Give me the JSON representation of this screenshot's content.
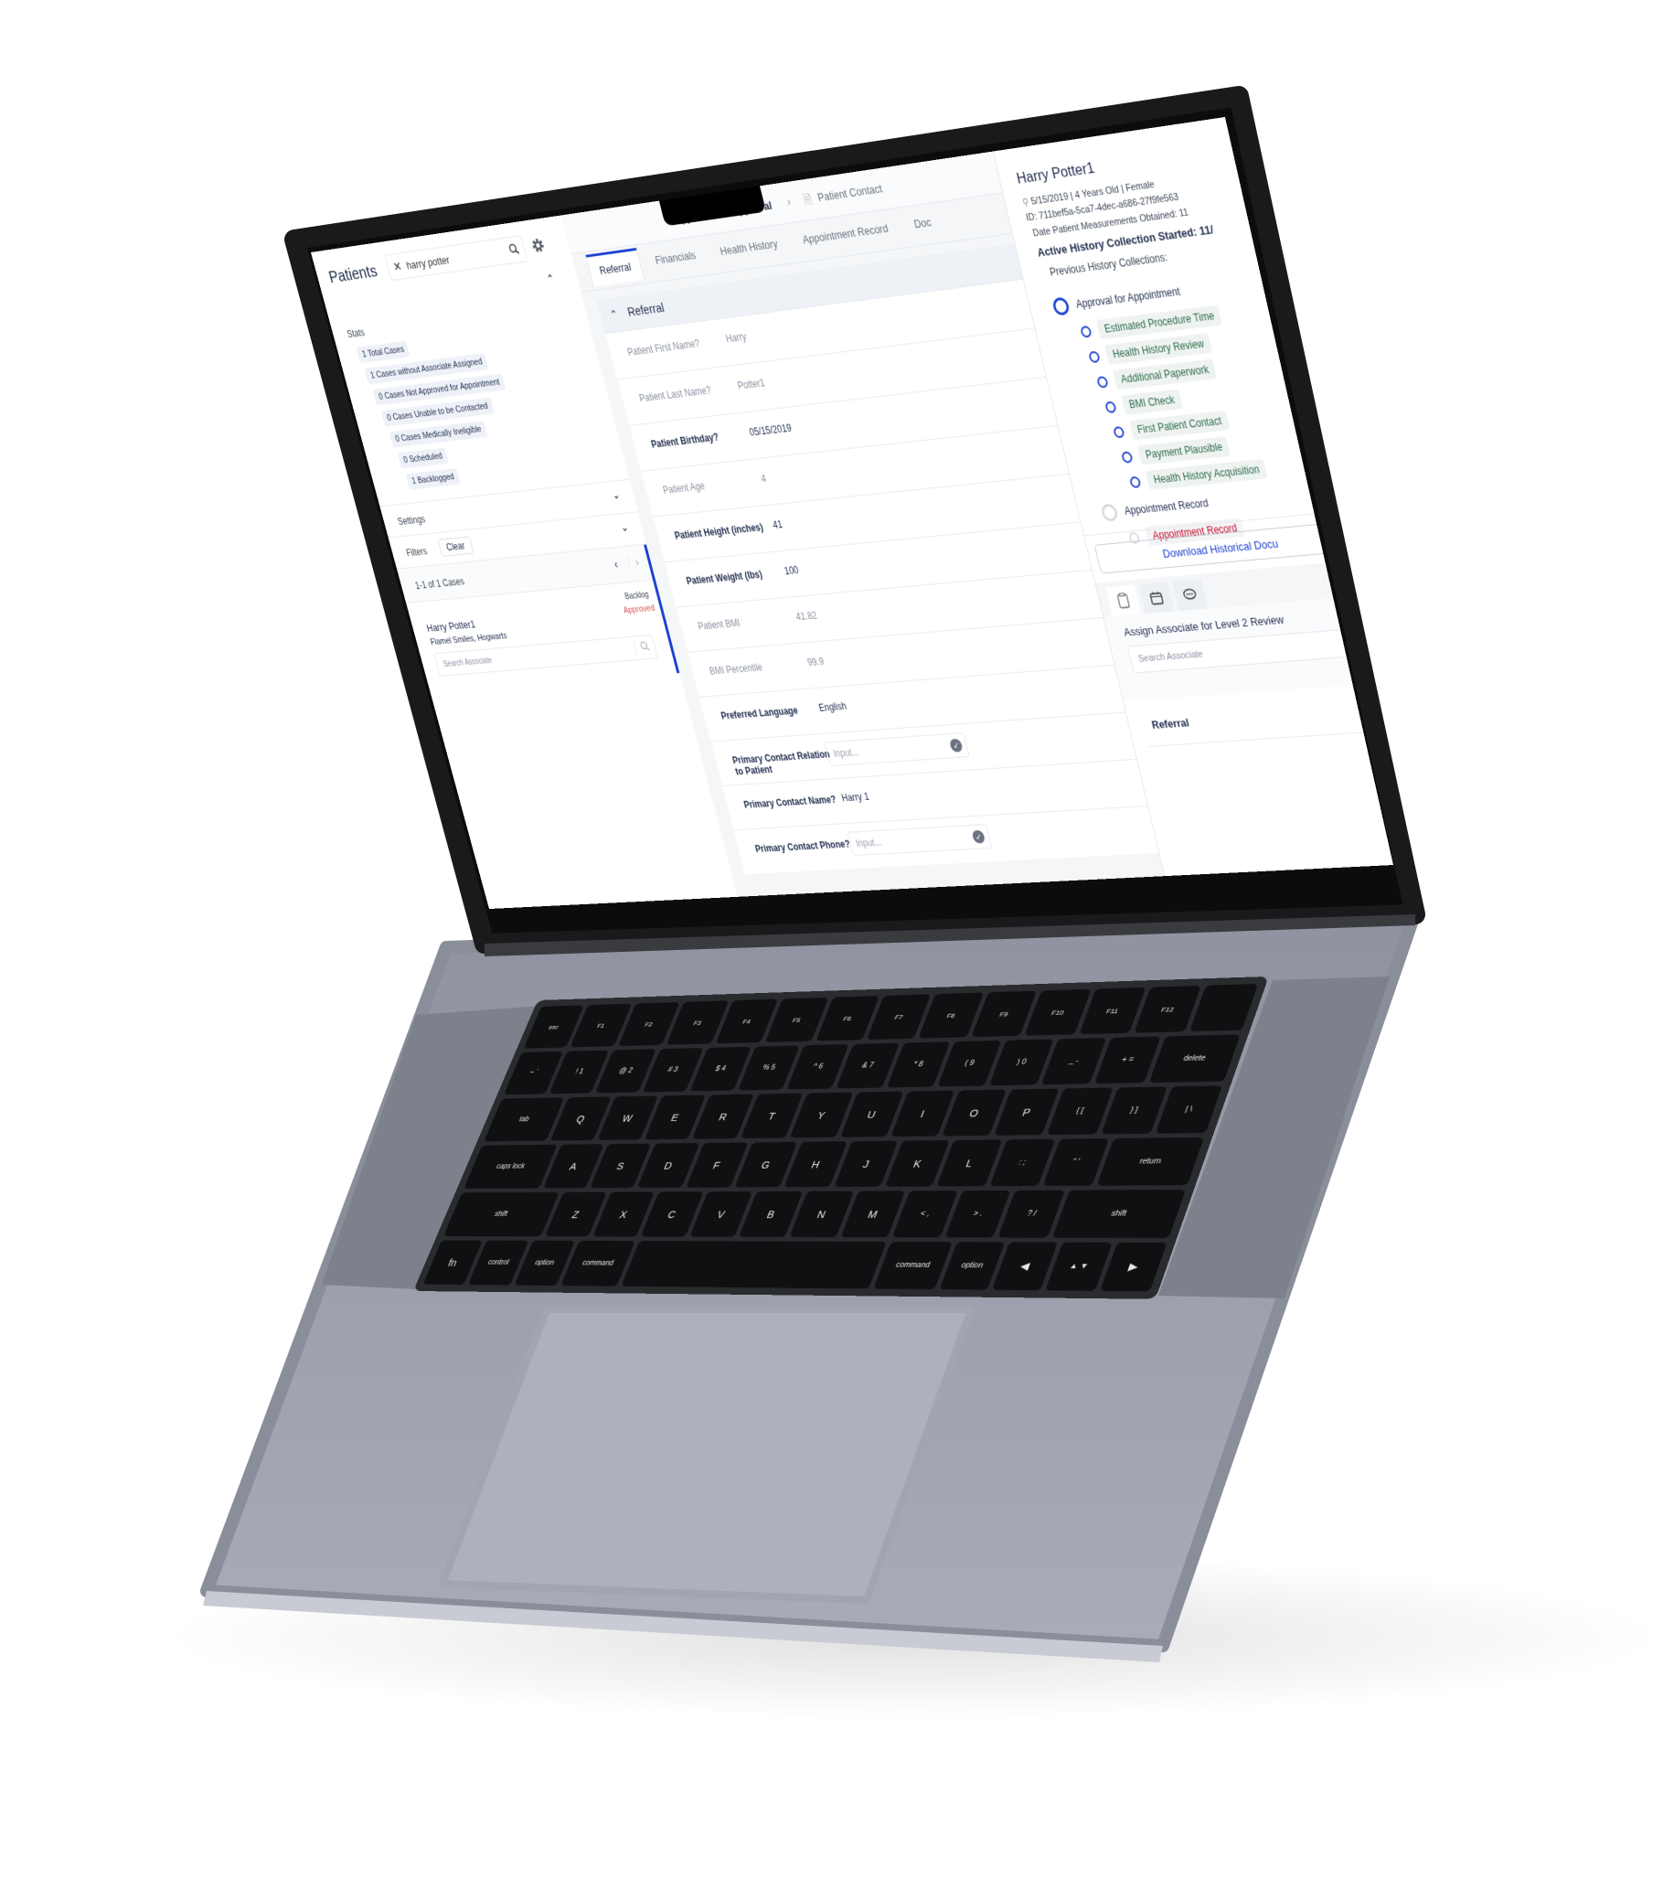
{
  "left": {
    "title": "Patients",
    "search_value": "harry potter",
    "stats_label": "Stats",
    "stats": [
      "1 Total Cases",
      "1 Cases without Associate Assigned",
      "0 Cases Not Approved for Appointment",
      "0 Cases Unable to be Contacted",
      "0 Cases Medically Ineligible",
      "0 Scheduled",
      "1 Backlogged"
    ],
    "settings_label": "Settings",
    "filters_label": "Filters",
    "clear_label": "Clear",
    "pagination": "1-1 of 1 Cases",
    "case": {
      "name": "Harry Potter1",
      "location": "Flamel Smiles, Hogwarts",
      "status": "Backlog",
      "approval": "Approved",
      "search_placeholder": "Search Associate"
    }
  },
  "middle": {
    "breadcrumb": [
      "Appointment Approval",
      "Patient Contact"
    ],
    "tabs": [
      "Referral",
      "Financials",
      "Health History",
      "Appointment Record",
      "Doc"
    ],
    "section_title": "Referral",
    "rows": [
      {
        "label": "Patient First Name?",
        "value": "Harry"
      },
      {
        "label": "Patient Last Name?",
        "value": "Potter1"
      },
      {
        "label": "Patient Birthday?",
        "value": "05/15/2019"
      },
      {
        "label": "Patient Age",
        "value": "4"
      },
      {
        "label": "Patient Height (inches)",
        "value": "41"
      },
      {
        "label": "Patient Weight (lbs)",
        "value": "100"
      },
      {
        "label": "Patient BMI",
        "value": "41.82"
      },
      {
        "label": "BMI Percentile",
        "value": "99.9"
      },
      {
        "label": "Preferred Language",
        "value": "English"
      },
      {
        "label": "Primary Contact Relation to Patient",
        "placeholder": "Input..."
      },
      {
        "label": "Primary Contact Name?",
        "value": "Harry 1"
      },
      {
        "label": "Primary Contact Phone?",
        "placeholder": "Input..."
      }
    ]
  },
  "right": {
    "name": "Harry Potter1",
    "demographics": "5/15/2019 | 4 Years Old | Female",
    "id": "ID: 711bef5a-5ca7-4dec-a686-27f9fe563",
    "measurements": "Date Patient Measurements Obtained: 11",
    "active_collection": "Active History Collection Started: 11/",
    "previous_collections": "Previous History Collections:",
    "steps": [
      {
        "label": "Approval for Appointment",
        "children": [
          "Estimated Procedure Time",
          "Health History Review",
          "Additional Paperwork",
          "BMI Check",
          "First Patient Contact",
          "Payment Plausible",
          "Health History Acquisition"
        ]
      },
      {
        "label": "Appointment Record",
        "children": [
          "Appointment Record"
        ]
      }
    ],
    "download_label": "Download Historical Docu",
    "icon_tabs": [
      "clipboard-icon",
      "calendar-icon",
      "chat-icon"
    ],
    "assign_label": "Assign Associate for Level 2 Review",
    "assign_placeholder": "Search Associate",
    "referral_label": "Referral"
  },
  "keyboard": {
    "rows": [
      [
        "esc",
        "F1",
        "F2",
        "F3",
        "F4",
        "F5",
        "F6",
        "F7",
        "F8",
        "F9",
        "F10",
        "F11",
        "F12",
        ""
      ],
      [
        "~ `",
        "! 1",
        "@ 2",
        "# 3",
        "$ 4",
        "% 5",
        "^ 6",
        "& 7",
        "* 8",
        "( 9",
        ") 0",
        "_ -",
        "+ =",
        "delete"
      ],
      [
        "tab",
        "Q",
        "W",
        "E",
        "R",
        "T",
        "Y",
        "U",
        "I",
        "O",
        "P",
        "{ [",
        "} ]",
        "| \\"
      ],
      [
        "caps lock",
        "A",
        "S",
        "D",
        "F",
        "G",
        "H",
        "J",
        "K",
        "L",
        ": ;",
        "\" '",
        "return"
      ],
      [
        "shift",
        "Z",
        "X",
        "C",
        "V",
        "B",
        "N",
        "M",
        "< ,",
        "> .",
        "? /",
        "shift"
      ],
      [
        "fn",
        "control",
        "option",
        "command",
        "",
        "command",
        "option",
        "◀",
        "▲ ▼",
        "▶"
      ]
    ]
  },
  "colors": {
    "accent": "#1a3fd1",
    "navy": "#1e2b4d",
    "green": "#2e6b4a",
    "red": "#c8102e",
    "laptop_body": "#9a9eab"
  }
}
